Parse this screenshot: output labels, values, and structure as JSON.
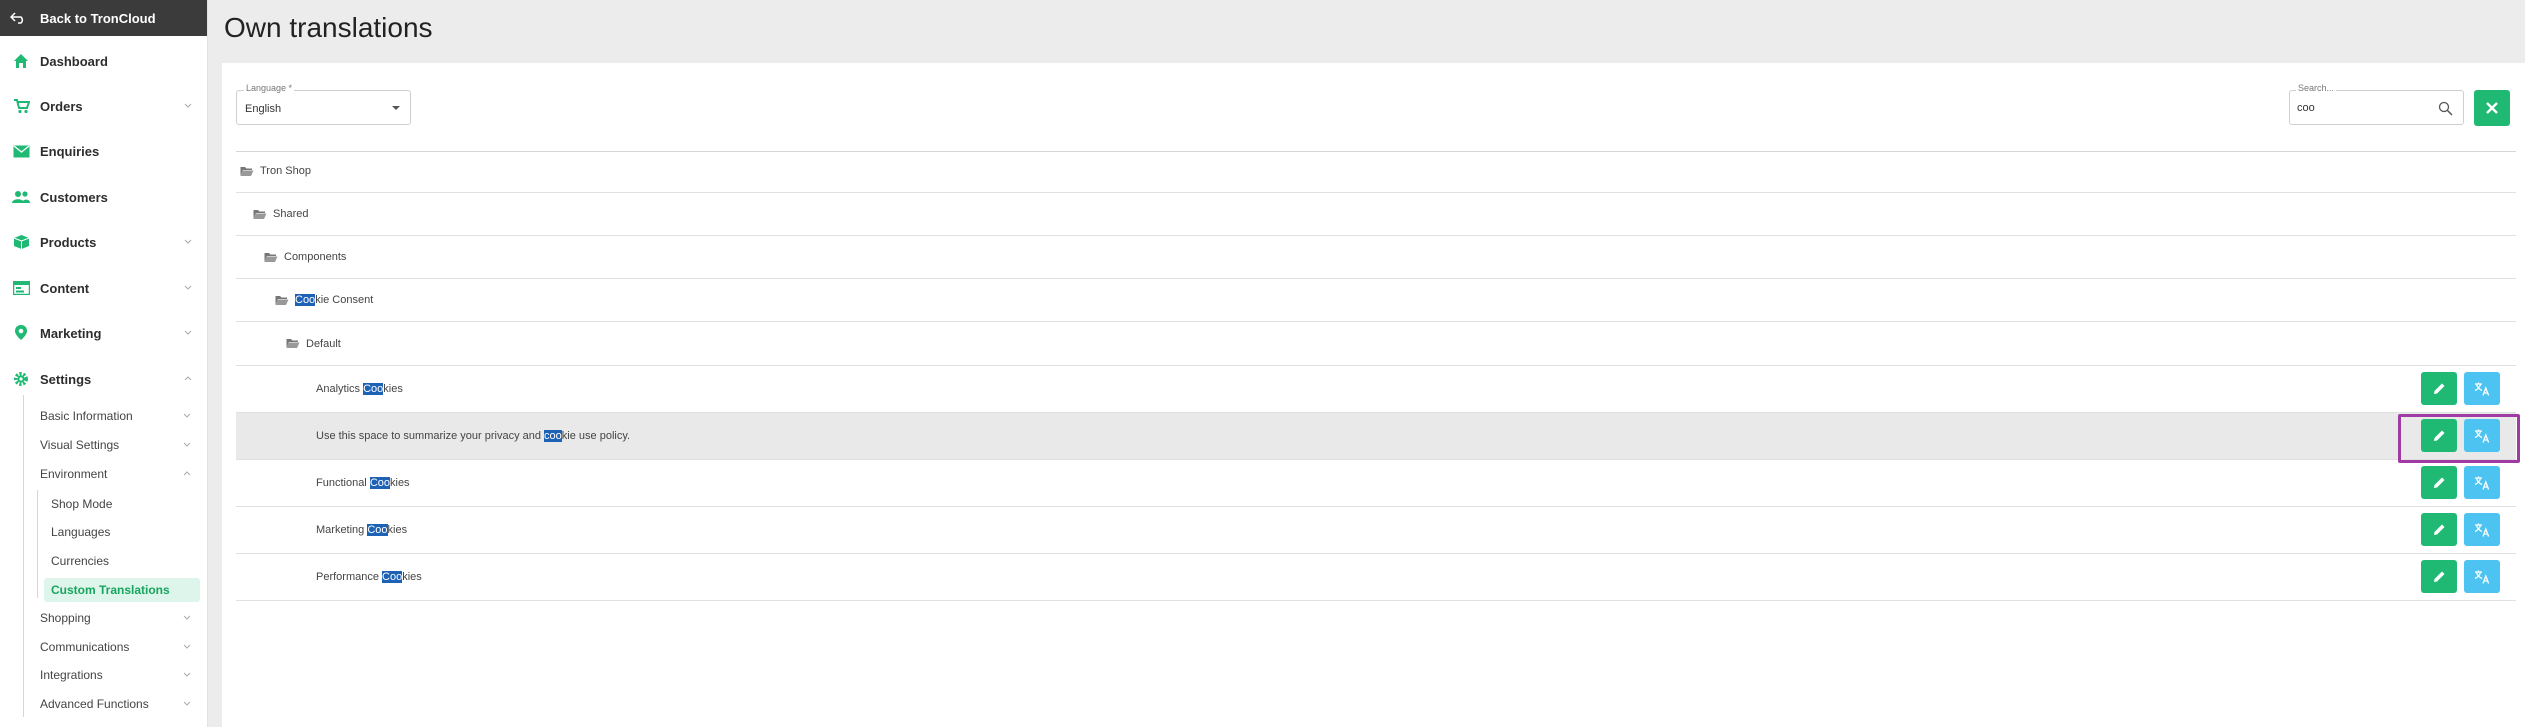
{
  "sidebar": {
    "back_label": "Back to TronCloud",
    "items": [
      {
        "label": "Dashboard",
        "icon": "home-icon"
      },
      {
        "label": "Orders",
        "icon": "cart-icon"
      },
      {
        "label": "Enquiries",
        "icon": "mail-icon"
      },
      {
        "label": "Customers",
        "icon": "users-icon"
      },
      {
        "label": "Products",
        "icon": "box-icon"
      },
      {
        "label": "Content",
        "icon": "layout-icon"
      },
      {
        "label": "Marketing",
        "icon": "pin-icon"
      },
      {
        "label": "Settings",
        "icon": "gear-icon"
      }
    ],
    "settings_sub": [
      {
        "label": "Basic Information"
      },
      {
        "label": "Visual Settings"
      },
      {
        "label": "Environment"
      },
      {
        "label": "Shopping"
      },
      {
        "label": "Communications"
      },
      {
        "label": "Integrations"
      },
      {
        "label": "Advanced Functions"
      }
    ],
    "environment_sub": [
      {
        "label": "Shop Mode"
      },
      {
        "label": "Languages"
      },
      {
        "label": "Currencies"
      },
      {
        "label": "Custom Translations"
      }
    ],
    "accent": "#1fb974"
  },
  "header": {
    "title": "Own translations"
  },
  "filters": {
    "language_label": "Language *",
    "language_value": "English",
    "search_label": "Search...",
    "search_value": "coo"
  },
  "tree": [
    {
      "type": "folder",
      "pre": "",
      "match": "",
      "post": "Tron Shop"
    },
    {
      "type": "folder",
      "pre": "",
      "match": "",
      "post": "Shared"
    },
    {
      "type": "folder",
      "pre": "",
      "match": "",
      "post": "Components"
    },
    {
      "type": "folder",
      "pre": "",
      "match": "Coo",
      "post": "kie Consent"
    },
    {
      "type": "folder",
      "pre": "",
      "match": "",
      "post": "Default"
    },
    {
      "type": "entry",
      "pre": "Analytics ",
      "match": "Coo",
      "post": "kies"
    },
    {
      "type": "entry",
      "pre": "Use this space to summarize your privacy and ",
      "match": "coo",
      "post": "kie use policy."
    },
    {
      "type": "entry",
      "pre": "Functional ",
      "match": "Coo",
      "post": "kies"
    },
    {
      "type": "entry",
      "pre": "Marketing ",
      "match": "Coo",
      "post": "kies"
    },
    {
      "type": "entry",
      "pre": "Performance ",
      "match": "Coo",
      "post": "kies"
    }
  ],
  "colors": {
    "edit_button": "#1fb974",
    "translate_button": "#4cc3f0",
    "highlight": "#1e62b5",
    "focus_outline": "#a03aa5"
  }
}
